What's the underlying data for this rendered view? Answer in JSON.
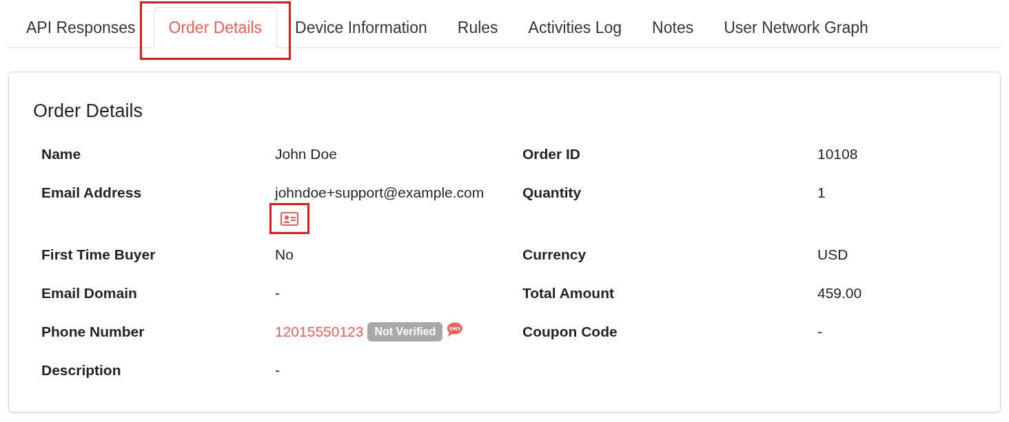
{
  "tabs": [
    {
      "label": "API Responses",
      "selected": false,
      "annotated": false
    },
    {
      "label": "Order Details",
      "selected": true,
      "annotated": true
    },
    {
      "label": "Device Information",
      "selected": false,
      "annotated": false
    },
    {
      "label": "Rules",
      "selected": false,
      "annotated": false
    },
    {
      "label": "Activities Log",
      "selected": false,
      "annotated": false
    },
    {
      "label": "Notes",
      "selected": false,
      "annotated": false
    },
    {
      "label": "User Network Graph",
      "selected": false,
      "annotated": false
    }
  ],
  "panel": {
    "title": "Order Details",
    "rows": [
      [
        {
          "kind": "text",
          "label": "Name",
          "value": "John Doe"
        },
        {
          "kind": "text",
          "label": "Order ID",
          "value": "10108"
        }
      ],
      [
        {
          "kind": "email",
          "label": "Email Address",
          "value": "johndoe+support@example.com",
          "icon_annotated": true
        },
        {
          "kind": "text",
          "label": "Quantity",
          "value": "1"
        }
      ],
      [
        {
          "kind": "text",
          "label": "First Time Buyer",
          "value": "No"
        },
        {
          "kind": "text",
          "label": "Currency",
          "value": "USD"
        }
      ],
      [
        {
          "kind": "text",
          "label": "Email Domain",
          "value": "-"
        },
        {
          "kind": "text",
          "label": "Total Amount",
          "value": "459.00"
        }
      ],
      [
        {
          "kind": "phone",
          "label": "Phone Number",
          "value": "12015550123",
          "badge": "Not Verified",
          "sms_label": "SMS"
        },
        {
          "kind": "text",
          "label": "Coupon Code",
          "value": "-"
        }
      ],
      [
        {
          "kind": "text",
          "label": "Description",
          "value": "-"
        }
      ]
    ]
  }
}
